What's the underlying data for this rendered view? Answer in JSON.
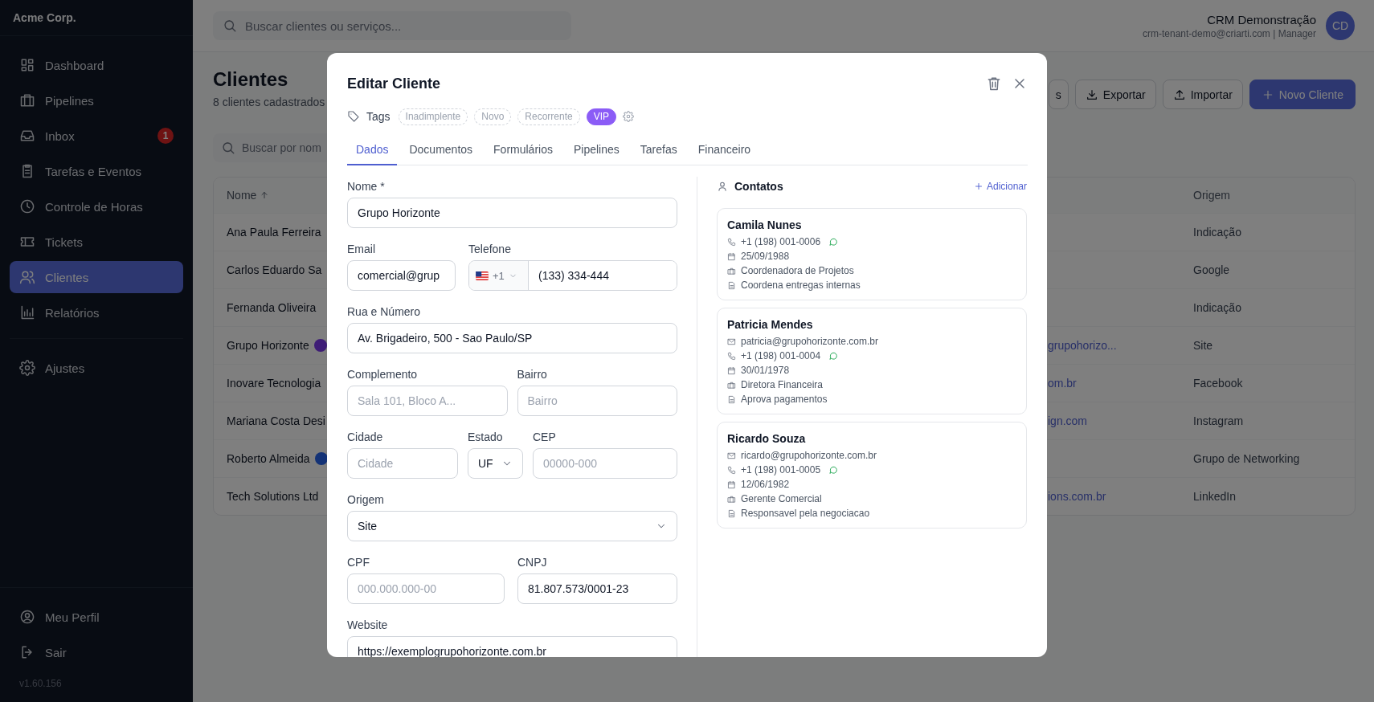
{
  "sidebar": {
    "brand": "Acme Corp.",
    "items": [
      {
        "label": "Dashboard",
        "selected": false
      },
      {
        "label": "Pipelines",
        "selected": false
      },
      {
        "label": "Inbox",
        "selected": false,
        "badge": "1"
      },
      {
        "label": "Tarefas e Eventos",
        "selected": false
      },
      {
        "label": "Controle de Horas",
        "selected": false
      },
      {
        "label": "Tickets",
        "selected": false
      },
      {
        "label": "Clientes",
        "selected": true
      },
      {
        "label": "Relatórios",
        "selected": false
      }
    ],
    "settings": [
      {
        "label": "Ajustes",
        "selected": false
      }
    ],
    "footer": [
      {
        "label": "Meu Perfil"
      },
      {
        "label": "Sair"
      }
    ],
    "version": "v1.60.156"
  },
  "topbar": {
    "search_placeholder": "Buscar clientes ou serviços...",
    "account_name": "CRM Demonstração",
    "account_detail": "crm-tenant-demo@criarti.com | Manager",
    "avatar": "CD"
  },
  "page": {
    "title": "Clientes",
    "subtitle": "8 clientes cadastrados",
    "actions": [
      {
        "label": "s",
        "kind": "outline"
      },
      {
        "label": "Exportar",
        "kind": "outline"
      },
      {
        "label": "Importar",
        "kind": "outline"
      },
      {
        "label": "Novo Cliente",
        "kind": "primary"
      }
    ],
    "search_placeholder": "Buscar por nom"
  },
  "table": {
    "columns": [
      {
        "label": "Nome",
        "sorted": true
      },
      {
        "label": "Origem",
        "sorted": false
      }
    ],
    "rows": [
      {
        "name": "Ana Paula Ferreira",
        "origin": "Indicação"
      },
      {
        "name": "Carlos Eduardo Sa",
        "origin": "Google"
      },
      {
        "name": "Fernanda Oliveira",
        "origin": "Indicação"
      },
      {
        "name": "Grupo Horizonte",
        "color": "#3e1d76",
        "email": "grupohorizo...",
        "origin": "Site"
      },
      {
        "name": "Inovare Tecnologia",
        "email": "om.br",
        "origin": "Facebook"
      },
      {
        "name": "Mariana Costa Desi",
        "email": "ign.com",
        "origin": "Instagram"
      },
      {
        "name": "Roberto Almeida",
        "color": "#133276",
        "origin": "Grupo de Networking"
      },
      {
        "name": "Tech Solutions Ltd",
        "email": "ions.com.br",
        "origin": "LinkedIn"
      }
    ]
  },
  "modal": {
    "title": "Editar Cliente",
    "tags_label": "Tags",
    "tags": [
      {
        "label": "Inadimplente",
        "selected": false
      },
      {
        "label": "Novo",
        "selected": false
      },
      {
        "label": "Recorrente",
        "selected": false
      },
      {
        "label": "VIP",
        "selected": true
      }
    ],
    "tabs": [
      {
        "label": "Dados",
        "selected": true
      },
      {
        "label": "Documentos",
        "selected": false
      },
      {
        "label": "Formulários",
        "selected": false
      },
      {
        "label": "Pipelines",
        "selected": false
      },
      {
        "label": "Tarefas",
        "selected": false
      },
      {
        "label": "Financeiro",
        "selected": false
      }
    ],
    "fields": [
      [
        {
          "label": "Nome *",
          "kind": "text",
          "value": "Grupo Horizonte"
        }
      ],
      [
        {
          "label": "Email",
          "kind": "text",
          "value": "comercial@grup"
        },
        {
          "label": "Telefone",
          "kind": "phone",
          "country_code": "+1",
          "value": "(133) 334-444"
        }
      ],
      [
        {
          "label": "Rua e Número",
          "kind": "text",
          "value": "Av. Brigadeiro, 500 - Sao Paulo/SP"
        }
      ],
      [
        {
          "label": "Complemento",
          "kind": "text",
          "placeholder": "Sala 101, Bloco A..."
        },
        {
          "label": "Bairro",
          "kind": "text",
          "placeholder": "Bairro"
        }
      ],
      [
        {
          "label": "Cidade",
          "kind": "text",
          "placeholder": "Cidade"
        },
        {
          "label": "Estado",
          "kind": "select",
          "value": "UF"
        },
        {
          "label": "CEP",
          "kind": "text",
          "placeholder": "00000-000"
        }
      ],
      [
        {
          "label": "Origem",
          "kind": "select",
          "value": "Site"
        }
      ],
      [
        {
          "label": "CPF",
          "kind": "text",
          "placeholder": "000.000.000-00"
        },
        {
          "label": "CNPJ",
          "kind": "text",
          "value": "81.807.573/0001-23"
        }
      ],
      [
        {
          "label": "Website",
          "kind": "text",
          "value": "https://exemplogrupohorizonte.com.br"
        }
      ]
    ],
    "contacts": {
      "title": "Contatos",
      "add_label": "Adicionar",
      "items": [
        {
          "name": "Camila Nunes",
          "lines": [
            {
              "kind": "phone",
              "text": "+1 (198) 001-0006",
              "whatsapp": true
            },
            {
              "kind": "date",
              "text": "25/09/1988"
            },
            {
              "kind": "role",
              "text": "Coordenadora de Projetos"
            },
            {
              "kind": "note",
              "text": "Coordena entregas internas"
            }
          ]
        },
        {
          "name": "Patricia Mendes",
          "lines": [
            {
              "kind": "email",
              "text": "patricia@grupohorizonte.com.br"
            },
            {
              "kind": "phone",
              "text": "+1 (198) 001-0004",
              "whatsapp": true
            },
            {
              "kind": "date",
              "text": "30/01/1978"
            },
            {
              "kind": "role",
              "text": "Diretora Financeira"
            },
            {
              "kind": "note",
              "text": "Aprova pagamentos"
            }
          ]
        },
        {
          "name": "Ricardo Souza",
          "lines": [
            {
              "kind": "email",
              "text": "ricardo@grupohorizonte.com.br"
            },
            {
              "kind": "phone",
              "text": "+1 (198) 001-0005",
              "whatsapp": true
            },
            {
              "kind": "date",
              "text": "12/06/1982"
            },
            {
              "kind": "role",
              "text": "Gerente Comercial"
            },
            {
              "kind": "note",
              "text": "Responsavel pela negociacao"
            }
          ]
        }
      ]
    }
  }
}
